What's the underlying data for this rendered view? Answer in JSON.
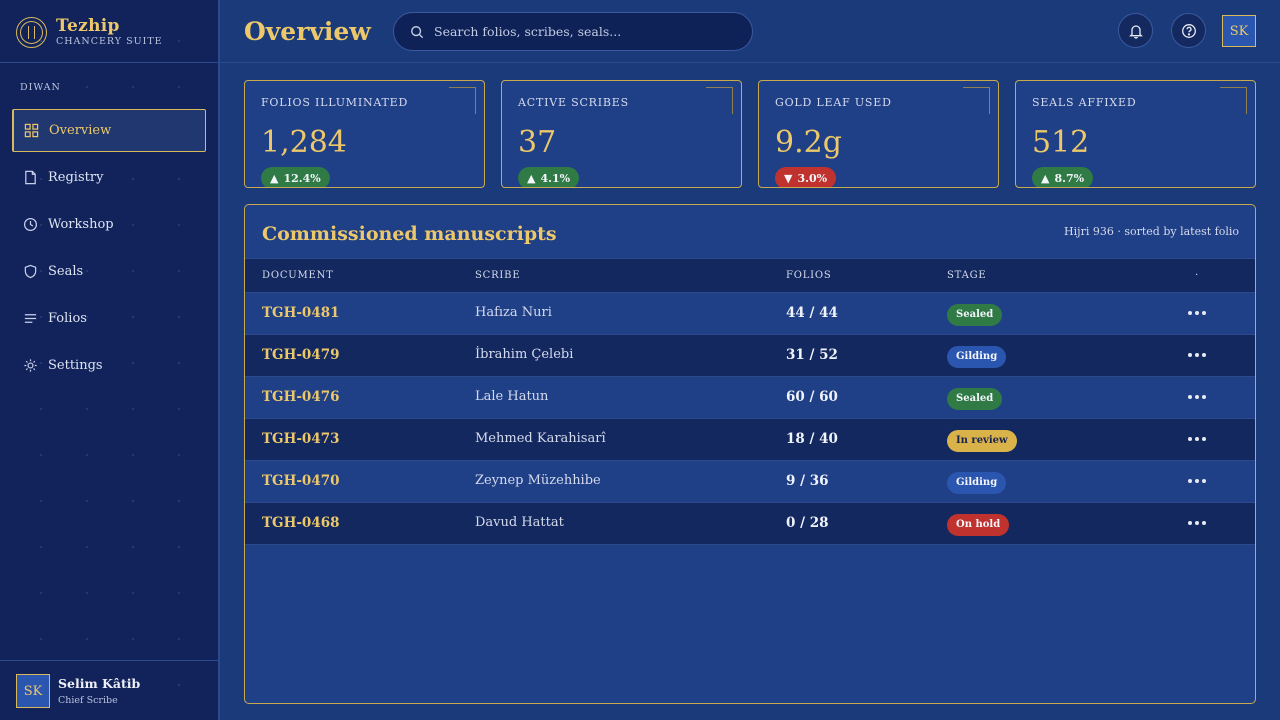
{
  "brand": {
    "name": "Tezhip",
    "subtitle": "CHANCERY SUITE"
  },
  "sidebar": {
    "section_label": "DIWAN",
    "items": [
      {
        "label": "Overview",
        "icon": "grid-icon",
        "active": true
      },
      {
        "label": "Registry",
        "icon": "document-icon",
        "active": false
      },
      {
        "label": "Workshop",
        "icon": "clock-icon",
        "active": false
      },
      {
        "label": "Seals",
        "icon": "shield-icon",
        "active": false
      },
      {
        "label": "Folios",
        "icon": "lines-icon",
        "active": false
      },
      {
        "label": "Settings",
        "icon": "sun-gear-icon",
        "active": false
      }
    ],
    "user": {
      "initials": "SK",
      "name": "Selim Kâtib",
      "role": "Chief Scribe"
    }
  },
  "header": {
    "title": "Overview",
    "search_placeholder": "Search folios, scribes, seals...",
    "avatar_initials": "SK"
  },
  "kpis": [
    {
      "label": "FOLIOS ILLUMINATED",
      "value": "1,284",
      "delta": "12.4%",
      "direction": "up"
    },
    {
      "label": "ACTIVE SCRIBES",
      "value": "37",
      "delta": "4.1%",
      "direction": "up"
    },
    {
      "label": "GOLD LEAF USED",
      "value": "9.2g",
      "delta": "3.0%",
      "direction": "down"
    },
    {
      "label": "SEALS AFFIXED",
      "value": "512",
      "delta": "8.7%",
      "direction": "up"
    }
  ],
  "table": {
    "title": "Commissioned manuscripts",
    "meta": "Hijri 936 · sorted by latest folio",
    "columns": [
      "DOCUMENT",
      "SCRIBE",
      "FOLIOS",
      "STAGE",
      "·"
    ],
    "rows": [
      {
        "doc": "TGH-0481",
        "scribe": "Hafıza Nuri",
        "folios": "44 / 44",
        "stage": "Sealed",
        "stage_kind": "sealed"
      },
      {
        "doc": "TGH-0479",
        "scribe": "İbrahim Çelebi",
        "folios": "31 / 52",
        "stage": "Gilding",
        "stage_kind": "gilding"
      },
      {
        "doc": "TGH-0476",
        "scribe": "Lale Hatun",
        "folios": "60 / 60",
        "stage": "Sealed",
        "stage_kind": "sealed"
      },
      {
        "doc": "TGH-0473",
        "scribe": "Mehmed Karahisarî",
        "folios": "18 / 40",
        "stage": "In review",
        "stage_kind": "review"
      },
      {
        "doc": "TGH-0470",
        "scribe": "Zeynep Müzehhibe",
        "folios": "9 / 36",
        "stage": "Gilding",
        "stage_kind": "gilding"
      },
      {
        "doc": "TGH-0468",
        "scribe": "Davud Hattat",
        "folios": "0 / 28",
        "stage": "On hold",
        "stage_kind": "hold"
      }
    ]
  },
  "colors": {
    "gold": "#ecc86a",
    "navy": "#1b3a7a",
    "sealed": "#2f7a45",
    "gilding": "#2a56b0",
    "review": "#d9b24a",
    "hold": "#c0322e"
  }
}
